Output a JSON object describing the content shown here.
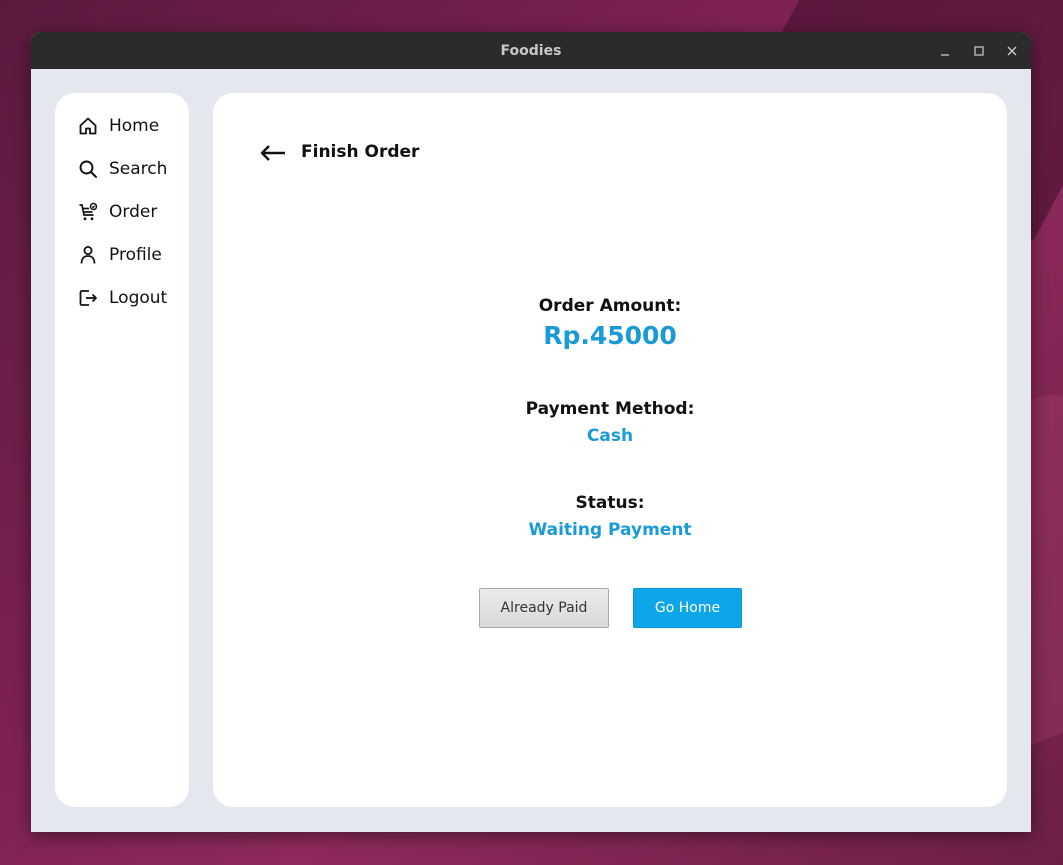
{
  "window": {
    "title": "Foodies"
  },
  "sidebar": {
    "items": [
      {
        "label": "Home",
        "icon": "home-icon"
      },
      {
        "label": "Search",
        "icon": "search-icon"
      },
      {
        "label": "Order",
        "icon": "cart-icon"
      },
      {
        "label": "Profile",
        "icon": "user-icon"
      },
      {
        "label": "Logout",
        "icon": "logout-icon"
      }
    ]
  },
  "page": {
    "title": "Finish Order",
    "order_amount_label": "Order Amount:",
    "order_amount_value": "Rp.45000",
    "payment_method_label": "Payment Method:",
    "payment_method_value": "Cash",
    "status_label": "Status:",
    "status_value": "Waiting Payment"
  },
  "actions": {
    "already_paid_label": "Already Paid",
    "go_home_label": "Go Home"
  },
  "colors": {
    "accent": "#0ea5e9",
    "value_text": "#1a9ad6"
  }
}
